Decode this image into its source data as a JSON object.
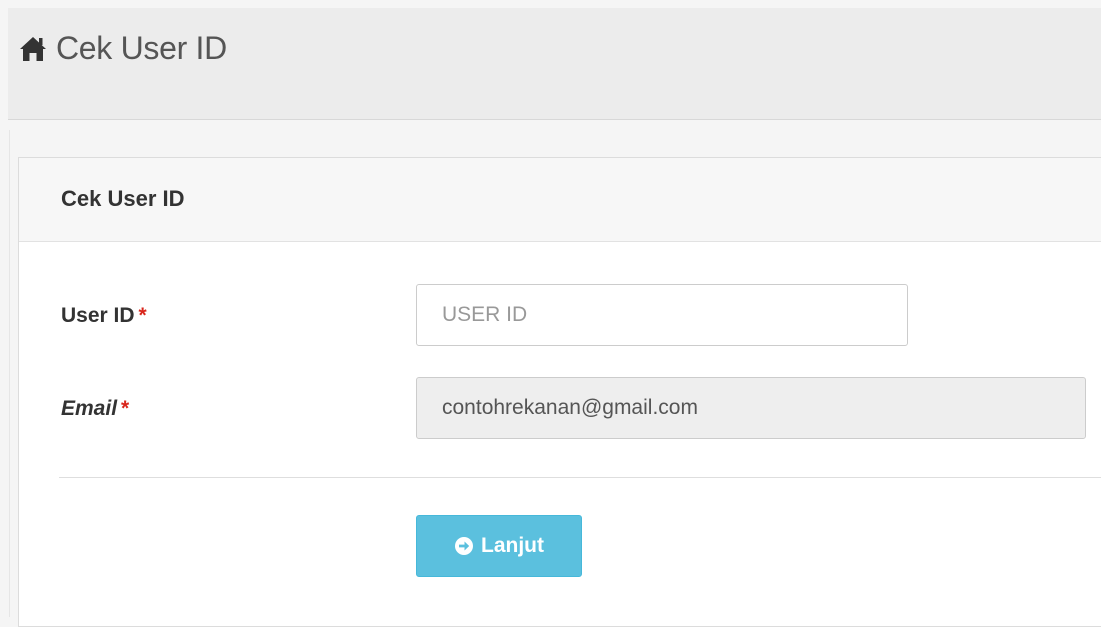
{
  "header": {
    "title": "Cek User ID",
    "icon": "home-icon"
  },
  "panel": {
    "title": "Cek User ID"
  },
  "form": {
    "user_id_label": "User ID",
    "user_id_required": "*",
    "user_id_placeholder": "USER ID",
    "user_id_value": "",
    "email_label": "Email",
    "email_required": "*",
    "email_value": "contohrekanan@gmail.com"
  },
  "actions": {
    "continue_label": "Lanjut",
    "continue_icon": "arrow-circle-right-icon"
  },
  "colors": {
    "button": "#5bc0de",
    "required": "#d9261c"
  }
}
